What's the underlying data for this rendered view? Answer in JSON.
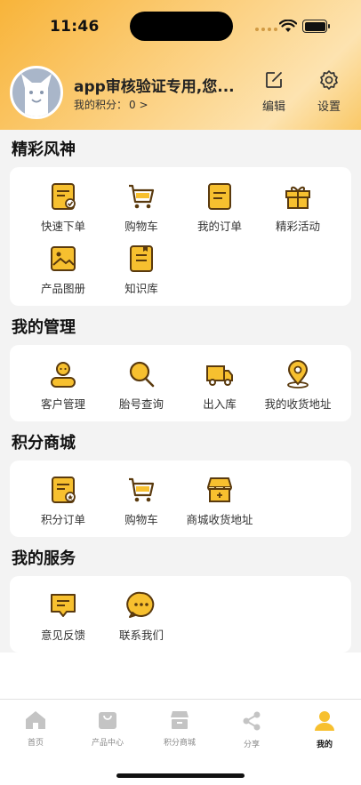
{
  "status_bar": {
    "time": "11:46"
  },
  "profile": {
    "name": "app审核验证专用,您...",
    "points_label": "我的积分：",
    "points_value": "0 >"
  },
  "header_actions": {
    "edit_label": "编辑",
    "settings_label": "设置"
  },
  "sections": [
    {
      "title": "精彩风神",
      "items": [
        {
          "label": "快速下单",
          "icon": "quick-order-icon"
        },
        {
          "label": "购物车",
          "icon": "cart-icon"
        },
        {
          "label": "我的订单",
          "icon": "order-icon"
        },
        {
          "label": "精彩活动",
          "icon": "gift-icon"
        },
        {
          "label": "产品图册",
          "icon": "gallery-icon"
        },
        {
          "label": "知识库",
          "icon": "knowledge-icon"
        }
      ]
    },
    {
      "title": "我的管理",
      "items": [
        {
          "label": "客户管理",
          "icon": "customer-icon"
        },
        {
          "label": "胎号查询",
          "icon": "search-icon"
        },
        {
          "label": "出入库",
          "icon": "truck-icon"
        },
        {
          "label": "我的收货地址",
          "icon": "location-icon"
        }
      ]
    },
    {
      "title": "积分商城",
      "items": [
        {
          "label": "积分订单",
          "icon": "points-order-icon"
        },
        {
          "label": "购物车",
          "icon": "cart-icon"
        },
        {
          "label": "商城收货地址",
          "icon": "shop-icon"
        }
      ]
    },
    {
      "title": "我的服务",
      "items": [
        {
          "label": "意见反馈",
          "icon": "feedback-icon"
        },
        {
          "label": "联系我们",
          "icon": "contact-icon"
        }
      ]
    }
  ],
  "tabbar": [
    {
      "label": "首页",
      "icon": "home-icon"
    },
    {
      "label": "产品中心",
      "icon": "product-icon"
    },
    {
      "label": "积分商城",
      "icon": "store-icon"
    },
    {
      "label": "分享",
      "icon": "share-icon"
    },
    {
      "label": "我的",
      "icon": "user-icon",
      "active": true
    }
  ],
  "colors": {
    "accent": "#f7c02f",
    "icon_stroke": "#5a3a0e",
    "header": "#f8b43a"
  }
}
